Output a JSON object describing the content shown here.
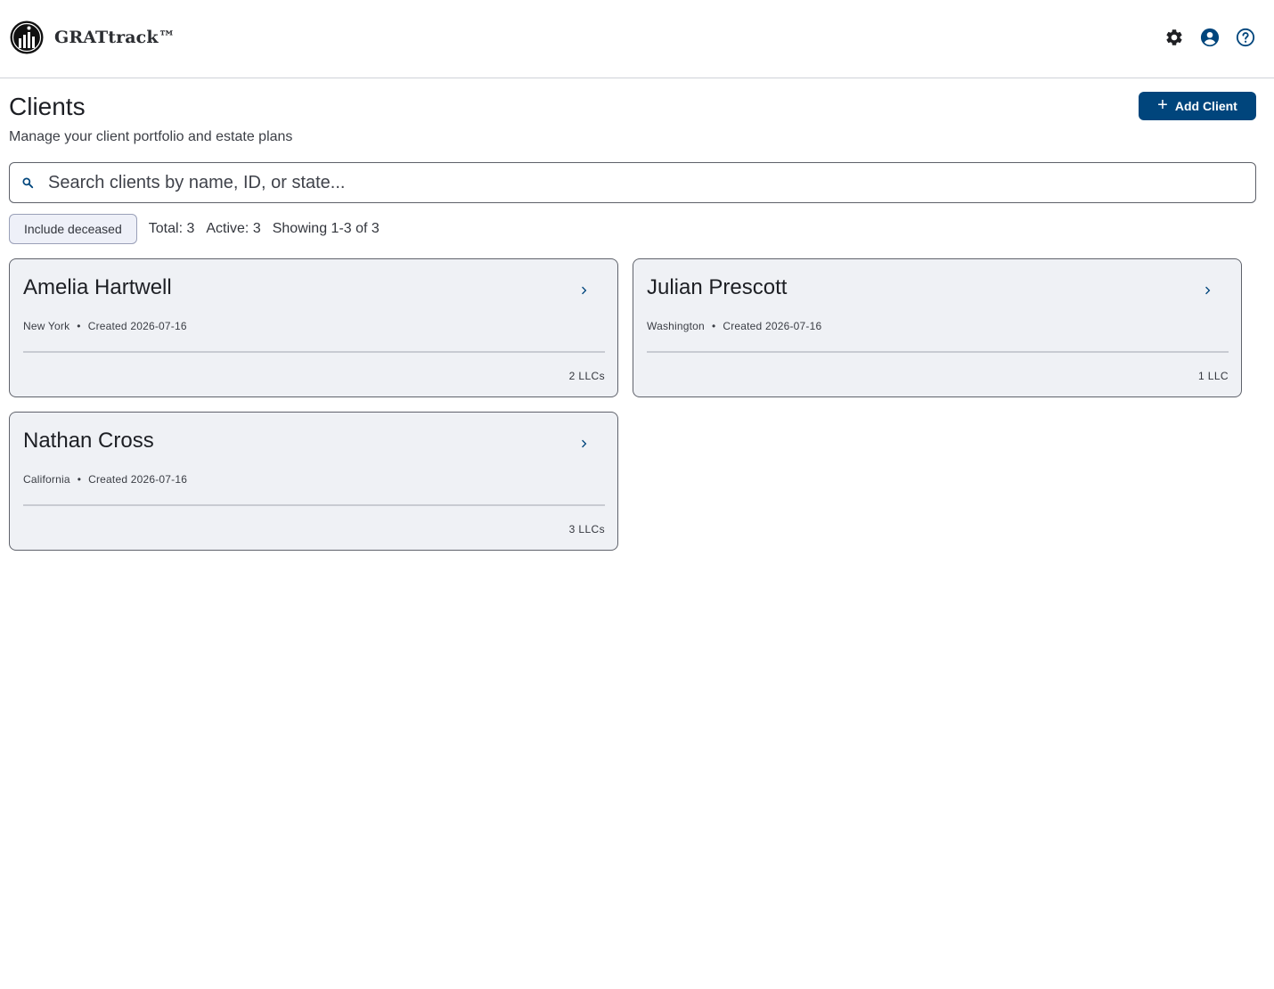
{
  "app": {
    "name": "GRATtrack™"
  },
  "header_icons": [
    "gear-icon",
    "account-circle-icon",
    "help-circle-icon"
  ],
  "page": {
    "title": "Clients",
    "subtitle": "Manage your client portfolio and estate plans",
    "add_button_label": "Add Client"
  },
  "search": {
    "placeholder": "Search clients by name, ID, or state..."
  },
  "filters": {
    "include_deceased_label": "Include deceased",
    "total": "Total: 3",
    "active": "Active: 3",
    "showing": "Showing 1-3 of 3"
  },
  "clients": [
    {
      "name": "Amelia Hartwell",
      "state": "New York",
      "created": "Created 2026-07-16",
      "llc_count": "2 LLCs"
    },
    {
      "name": "Julian Prescott",
      "state": "Washington",
      "created": "Created 2026-07-16",
      "llc_count": "1 LLC"
    },
    {
      "name": "Nathan Cross",
      "state": "California",
      "created": "Created 2026-07-16",
      "llc_count": "3 LLCs"
    }
  ],
  "colors": {
    "primary": "#00457c",
    "card_bg": "#eff1f5",
    "chip_bg": "#eef0f8"
  }
}
